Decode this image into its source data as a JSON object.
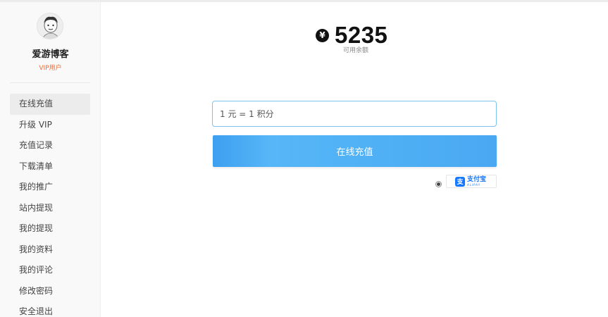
{
  "user": {
    "name": "爱游博客",
    "level": "VIP用户"
  },
  "menu": {
    "items": [
      {
        "label": "在线充值"
      },
      {
        "label": "升级 VIP"
      },
      {
        "label": "充值记录"
      },
      {
        "label": "下载清单"
      },
      {
        "label": "我的推广"
      },
      {
        "label": "站内提现"
      },
      {
        "label": "我的提现"
      },
      {
        "label": "我的资料"
      },
      {
        "label": "我的评论"
      },
      {
        "label": "修改密码"
      },
      {
        "label": "安全退出"
      }
    ],
    "active": "在线充值"
  },
  "balance": {
    "currency_symbol": "¥",
    "amount": "5235",
    "label": "可用余额"
  },
  "recharge": {
    "input_placeholder": "1 元 = 1 积分",
    "button_label": "在线充值"
  },
  "payment": {
    "method_cn": "支付宝",
    "method_en": "ALIPAY",
    "icon_char": "支",
    "selected": true
  },
  "colors": {
    "accent": "#4aabf3",
    "vip": "#f06a35",
    "alipay": "#1677ff"
  }
}
